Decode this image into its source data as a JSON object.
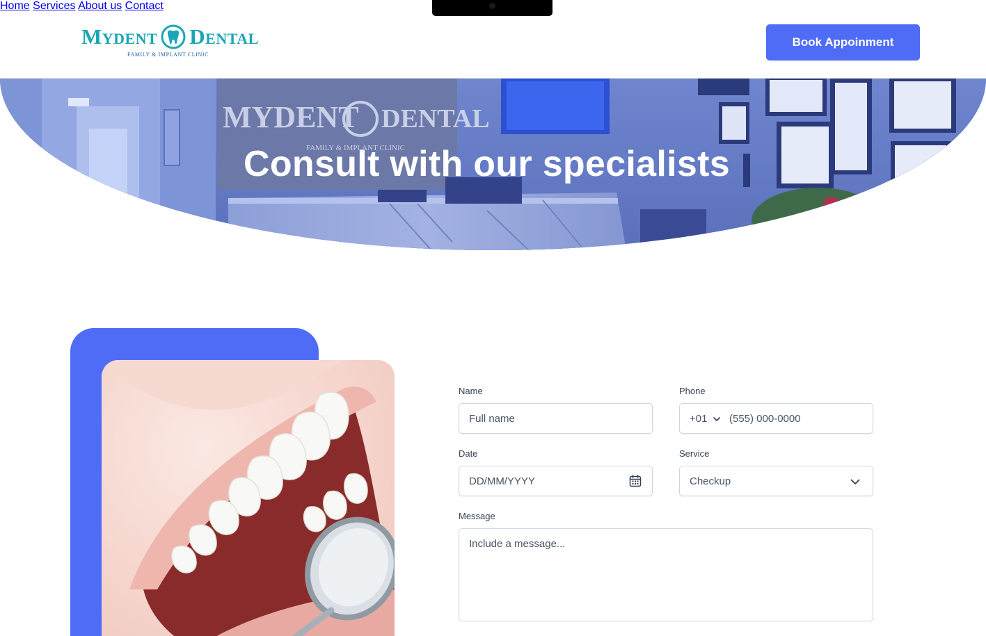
{
  "brand": {
    "name_left": "Mydent",
    "name_right": "Dental",
    "tagline": "Family & Implant Clinic",
    "colors": {
      "logo": "#1aa6b7",
      "accent": "#4f6cf7"
    }
  },
  "nav": {
    "items": [
      {
        "label": "Home"
      },
      {
        "label": "Services"
      },
      {
        "label": "About us"
      },
      {
        "label": "Contact"
      }
    ],
    "cta_label": "Book Appoinment"
  },
  "hero": {
    "title": "Consult with our specialists",
    "background": "clinic reception photo with blue overlay"
  },
  "form": {
    "name": {
      "label": "Name",
      "placeholder": "Full name"
    },
    "phone": {
      "label": "Phone",
      "country_code": "+01",
      "placeholder": "(555) 000-0000"
    },
    "date": {
      "label": "Date",
      "placeholder": "DD/MM/YYYY",
      "icon": "calendar-icon"
    },
    "service": {
      "label": "Service",
      "value": "Checkup",
      "icon": "chevron-down-icon"
    },
    "message": {
      "label": "Message",
      "placeholder": "Include a message..."
    }
  }
}
